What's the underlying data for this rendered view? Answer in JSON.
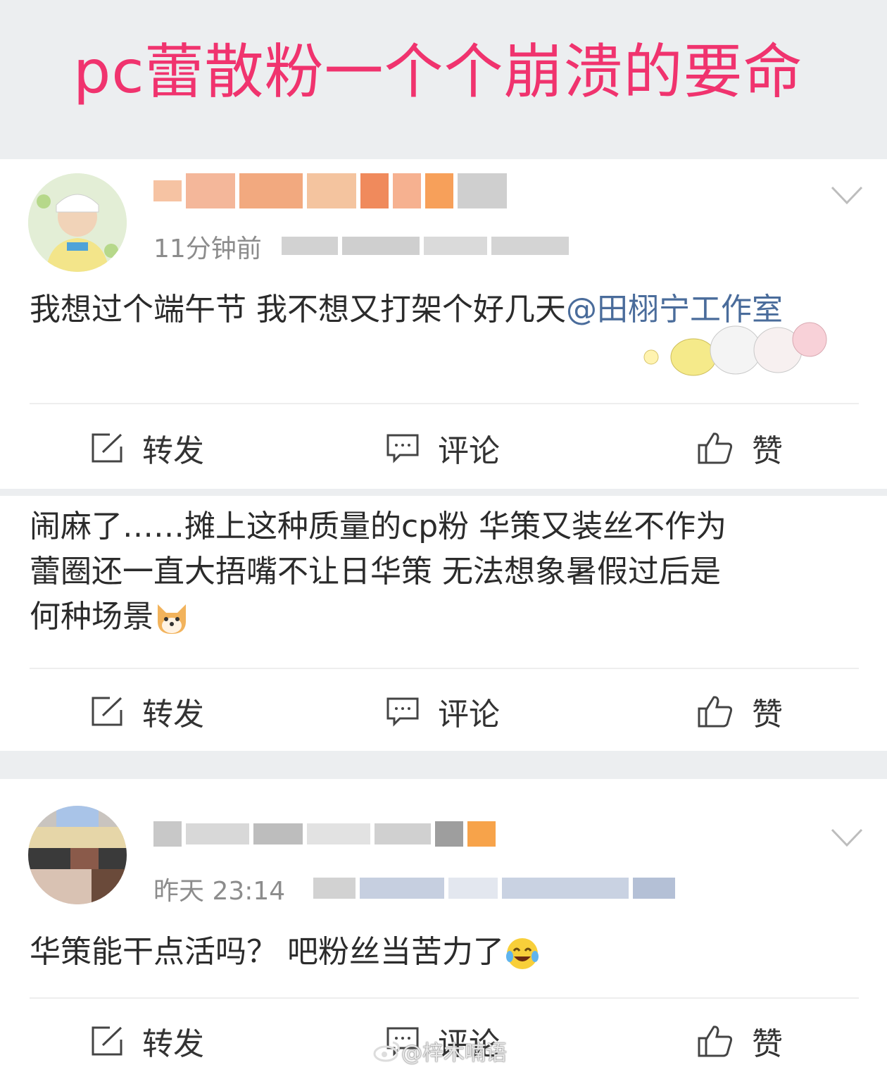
{
  "banner": {
    "title": "pc蕾散粉一个个崩溃的要命"
  },
  "posts": [
    {
      "time": "11分钟前",
      "text": "我想过个端午节 我不想又打架个好几天",
      "mention": "@田栩宁工作室",
      "actions": {
        "repost": "转发",
        "comment": "评论",
        "like": "赞"
      }
    },
    {
      "text_lines": [
        "闹麻了……摊上这种质量的cp粉 华策又装丝不作为",
        "蕾圈还一直大捂嘴不让日华策 无法想象暑假过后是",
        "何种场景"
      ],
      "actions": {
        "repost": "转发",
        "comment": "评论",
        "like": "赞"
      }
    },
    {
      "time": "昨天 23:14",
      "text": "华策能干点活吗？ 吧粉丝当苦力了",
      "actions": {
        "repost": "转发",
        "comment": "评论",
        "like": "赞"
      }
    }
  ],
  "watermark": "@梓木喃语",
  "colors": {
    "accent": "#f0336e",
    "mention": "#4a6c9b",
    "background": "#eceef0"
  }
}
